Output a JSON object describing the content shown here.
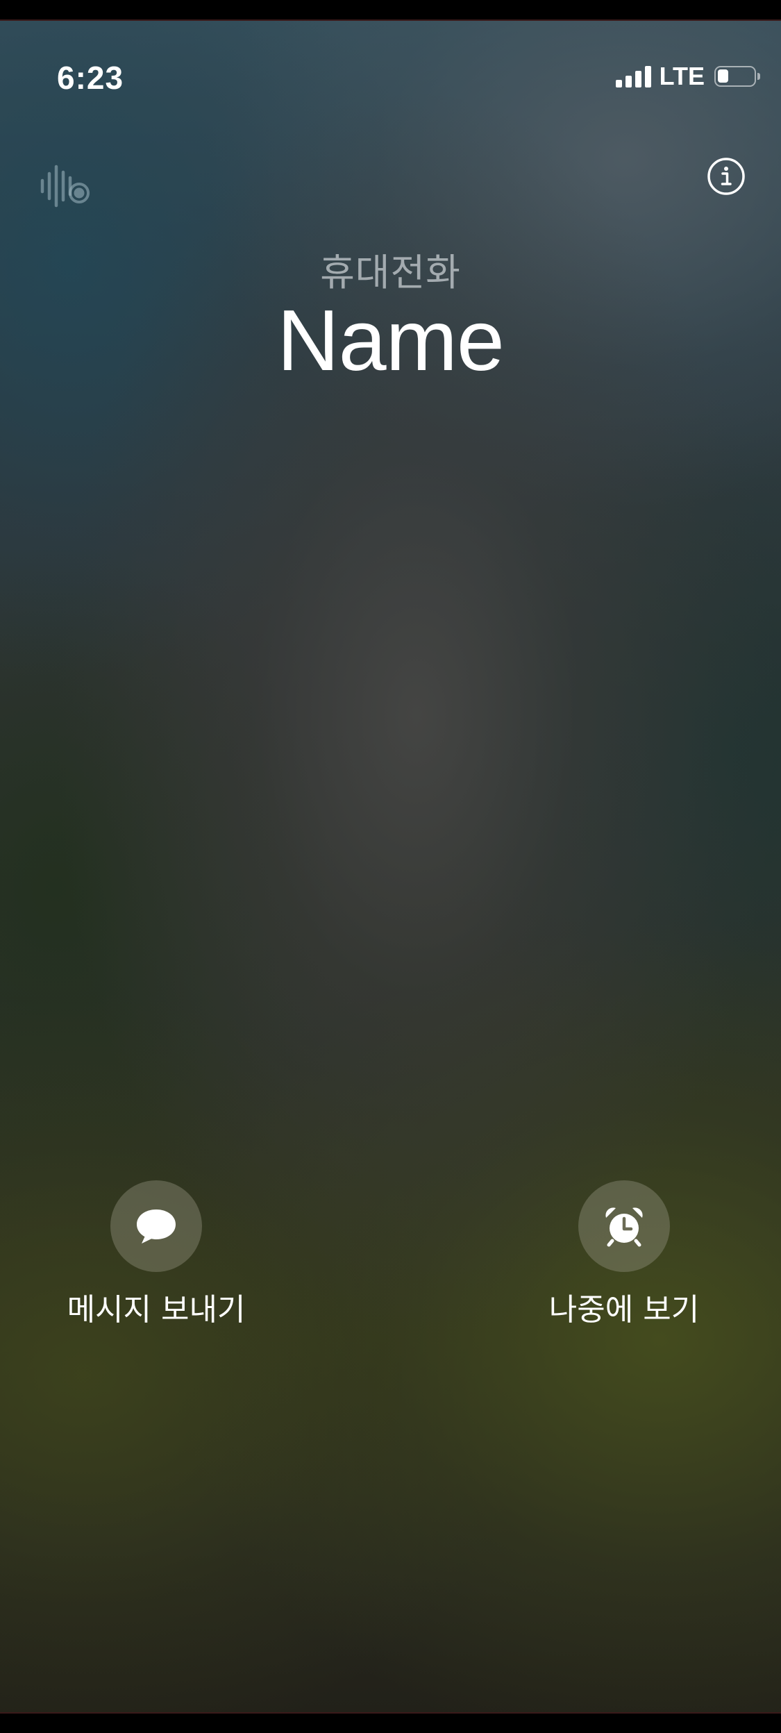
{
  "status_bar": {
    "time": "6:23",
    "network": "LTE",
    "signal_bars": 4,
    "battery_level": 0.3
  },
  "icons": {
    "voice": "voice-waveform-icon",
    "info": "info-icon",
    "message": "message-bubble-icon",
    "alarm": "alarm-clock-icon"
  },
  "caller": {
    "label": "휴대전화",
    "name": "Name"
  },
  "actions": {
    "message_label": "메시지 보내기",
    "remind_label": "나중에 보기"
  },
  "colors": {
    "action_circle": "#6b6b55",
    "caller_label": "#c8cdd2"
  }
}
